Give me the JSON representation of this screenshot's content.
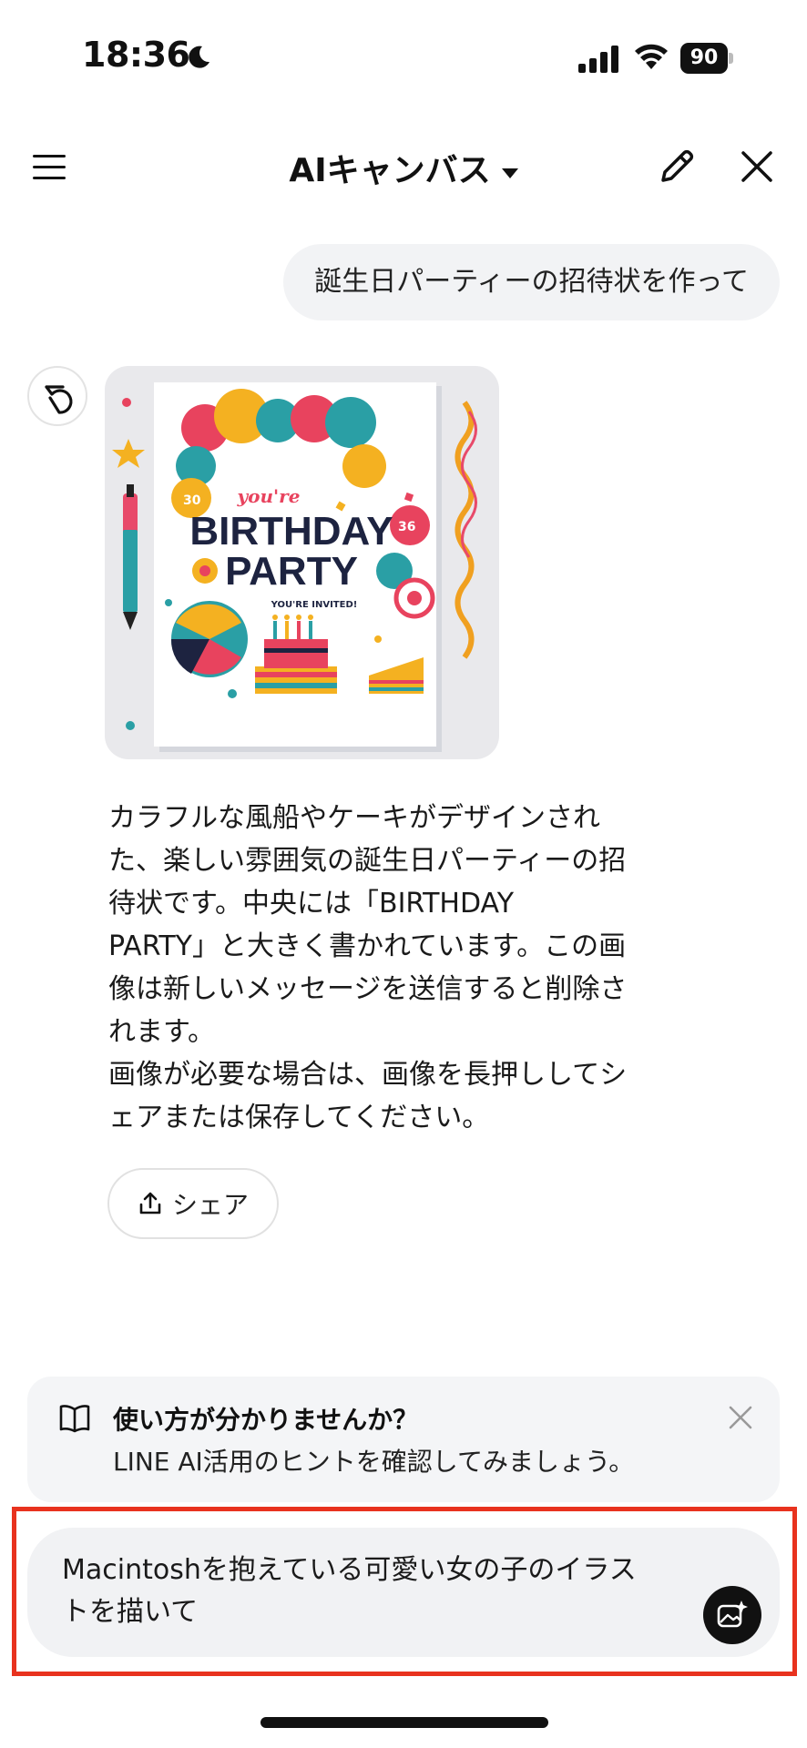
{
  "status_bar": {
    "time": "18:36",
    "battery": "90"
  },
  "header": {
    "title": "AIキャンバス"
  },
  "chat": {
    "user_message": "誕生日パーティーの招待状を作って",
    "ai_response": {
      "image": {
        "card_top_text": "you're",
        "card_title_line1": "BIRTHDAY",
        "card_title_line2": "PARTY",
        "card_subtitle": "YOU'RE INVITED!",
        "balloon_number_left": "30",
        "balloon_number_right": "36"
      },
      "text_lines": [
        "カラフルな風船やケーキがデザインされ",
        "た、楽しい雰囲気の誕生日パーティーの招",
        "待状です。中央には「BIRTHDAY",
        "PARTY」と大きく書かれています。この画",
        "像は新しいメッセージを送信すると削除さ",
        "れます。",
        "画像が必要な場合は、画像を長押ししてシ",
        "ェアまたは保存してください。"
      ],
      "share_label": "シェア"
    }
  },
  "hint": {
    "title": "使い方が分かりませんか？",
    "body": "LINE AI活用のヒントを確認してみましょう。"
  },
  "composer": {
    "text_lines": [
      "Macintoshを抱えている可愛い女の子のイラス",
      "トを描いて"
    ]
  },
  "colors": {
    "highlight": "#e8321e",
    "bubble": "#f2f3f5",
    "icon": "#111111"
  }
}
